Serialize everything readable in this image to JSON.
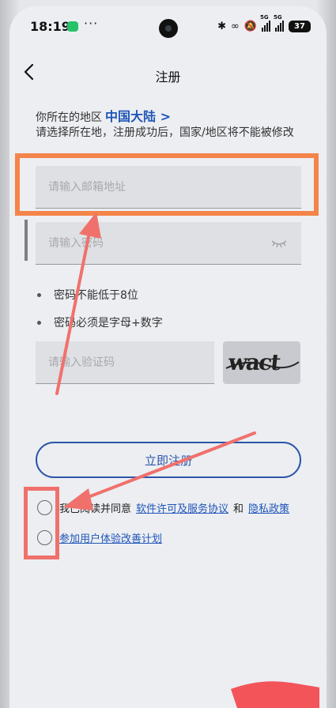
{
  "status": {
    "time": "18:19",
    "more": "···",
    "battery": "37",
    "net_tag_1": "5G",
    "net_tag_2": "5G"
  },
  "header": {
    "title": "注册"
  },
  "region": {
    "label": "你所在的地区",
    "value": "中国大陆 >",
    "note": "请选择所在地，注册成功后，国家/地区将不能被修改"
  },
  "form": {
    "email_placeholder": "请输入邮箱地址",
    "password_placeholder": "请输入密码",
    "rules": [
      "密码不能低于8位",
      "密码必须是字母+数字"
    ],
    "captcha_placeholder": "请输入验证码",
    "captcha_text": "wact",
    "register_label": "立即注册"
  },
  "agreements": {
    "read_prefix": "我已阅读并同意",
    "license_link": "软件许可及服务协议",
    "and": "和",
    "privacy_link": "隐私政策",
    "experience_link": "参加用户体验改善计划"
  },
  "colors": {
    "accent": "#1f55b8",
    "annotation_orange": "#f4844a",
    "annotation_red": "#f0716c"
  }
}
